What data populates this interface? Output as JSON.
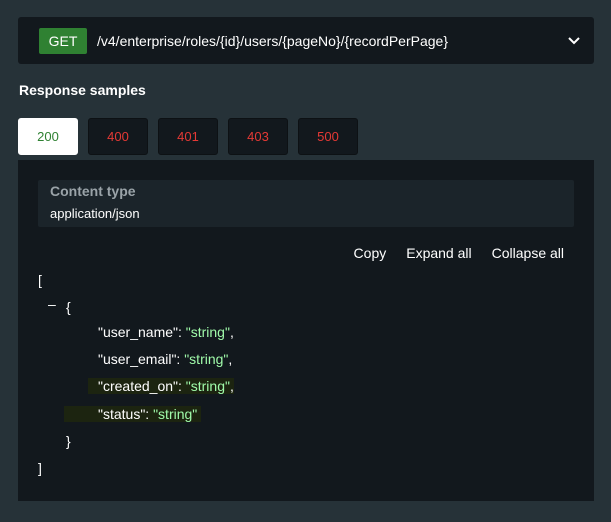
{
  "endpoint": {
    "method": "GET",
    "path": "/v4/enterprise/roles/{id}/users/{pageNo}/{recordPerPage}"
  },
  "section_title": "Response samples",
  "tabs": [
    {
      "label": "200",
      "active": true
    },
    {
      "label": "400",
      "active": false
    },
    {
      "label": "401",
      "active": false
    },
    {
      "label": "403",
      "active": false
    },
    {
      "label": "500",
      "active": false
    }
  ],
  "content_type": {
    "label": "Content type",
    "value": "application/json"
  },
  "actions": {
    "copy": "Copy",
    "expand_all": "Expand all",
    "collapse_all": "Collapse all"
  },
  "code": {
    "open_array": "[",
    "collapse_toggle": "–",
    "open_object": "{",
    "fields": [
      {
        "key": "\"user_name\"",
        "value": "\"string\"",
        "trail": ","
      },
      {
        "key": "\"user_email\"",
        "value": "\"string\"",
        "trail": ","
      },
      {
        "key": "\"created_on\"",
        "value": "\"string\"",
        "trail": ","
      },
      {
        "key": "\"status\"",
        "value": "\"string\"",
        "trail": ""
      }
    ],
    "close_object": "}",
    "close_array": "]"
  },
  "colors": {
    "background": "#263238",
    "panel": "#12181d",
    "get_method": "#2f8132",
    "error_tab_text": "#e53935",
    "json_string": "#a0fbaa"
  }
}
